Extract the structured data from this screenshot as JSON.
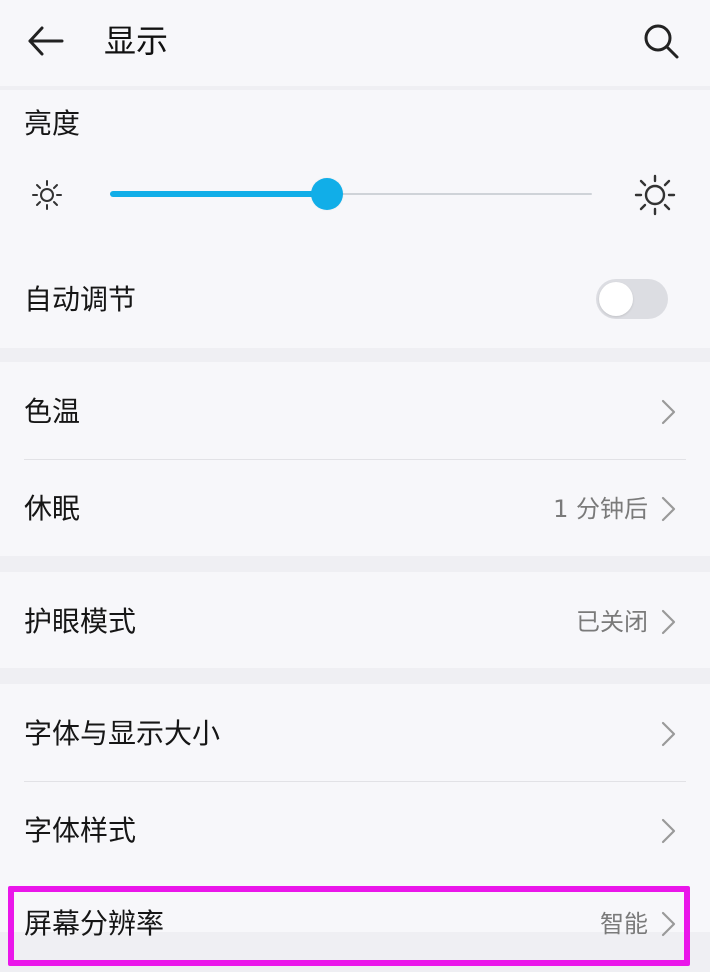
{
  "app_bar": {
    "title": "显示"
  },
  "icons": {
    "back": "arrow-left",
    "search": "search",
    "brightness_low": "sun-small",
    "brightness_high": "sun-large",
    "chevron": "chevron-right"
  },
  "brightness": {
    "title": "亮度",
    "level_percent": 45
  },
  "auto_adjust": {
    "label": "自动调节",
    "enabled": false
  },
  "rows": [
    {
      "label": "色温",
      "value": ""
    },
    {
      "label": "休眠",
      "value": "1 分钟后"
    },
    {
      "label": "护眼模式",
      "value": "已关闭"
    },
    {
      "label": "字体与显示大小",
      "value": ""
    },
    {
      "label": "字体样式",
      "value": ""
    },
    {
      "label": "屏幕分辨率",
      "value": "智能"
    }
  ],
  "colors": {
    "accent": "#11AEE8",
    "highlight": "#EA16EA"
  }
}
